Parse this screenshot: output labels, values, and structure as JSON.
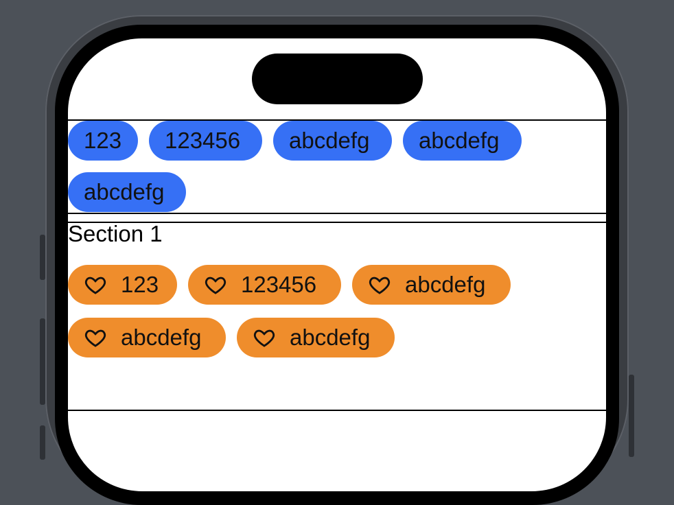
{
  "colors": {
    "blue_tag": "#3670f5",
    "orange_tag": "#ef8d2c",
    "screen_background": "#ffffff",
    "outside_background": "#4c5158"
  },
  "top_tags": [
    {
      "label": "123"
    },
    {
      "label": "123456"
    },
    {
      "label": "abcdefg"
    },
    {
      "label": "abcdefg"
    },
    {
      "label": "abcdefg"
    }
  ],
  "section": {
    "title": "Section 1",
    "icon": "heart-icon",
    "tags": [
      {
        "label": "123"
      },
      {
        "label": "123456"
      },
      {
        "label": "abcdefg"
      },
      {
        "label": "abcdefg"
      },
      {
        "label": "abcdefg"
      }
    ]
  }
}
